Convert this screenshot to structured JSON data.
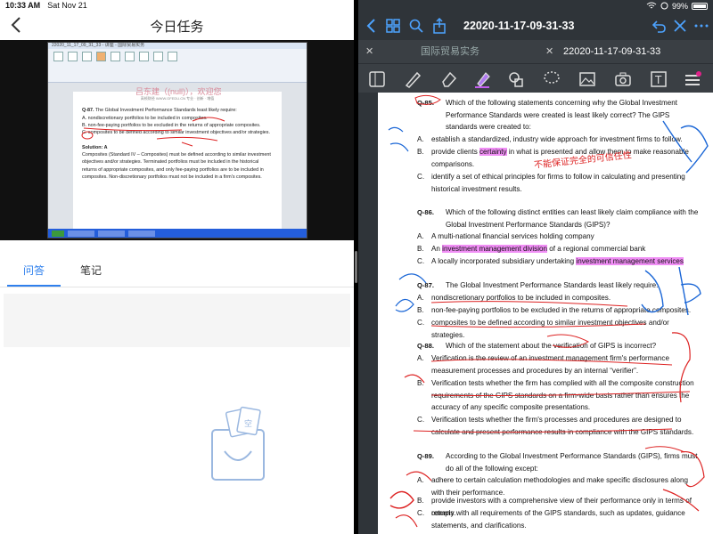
{
  "left": {
    "status": {
      "time": "10:33 AM",
      "date": "Sat Nov 21"
    },
    "nav": {
      "title": "今日任务"
    },
    "video": {
      "window_title": "22020_11_17_09_31_33 - 讲座 - 国际贸易实务",
      "watermark": "吕东建（(null)），欢迎您",
      "doc_header": "高顿财经 WWW.GFEDU.CN 专业 · 创新 · 增值",
      "q_num": "Q-87.",
      "q_text": "The Global Investment Performance Standards least likely require:",
      "options": [
        {
          "letter": "A.",
          "text": "nondiscretionary portfolios to be included in composites."
        },
        {
          "letter": "B.",
          "text": "non-fee-paying portfolios to be excluded in the returns of appropriate composites."
        },
        {
          "letter": "C.",
          "text": "composites to be defined according to similar investment objectives and/or strategies."
        }
      ],
      "solution_label": "Solution: A",
      "solution_text": "Composites (Standard IV – Composites) must be defined according to similar investment objectives and/or strategies. Terminated portfolios must be included in the historical returns of appropriate composites, and only fee-paying portfolios are to be included in composites. Non-discretionary portfolios must not be included in a firm's composites."
    },
    "tabs": [
      {
        "label": "问答"
      },
      {
        "label": "笔记"
      }
    ],
    "empty_text": "空"
  },
  "right": {
    "status": {
      "battery": "99%"
    },
    "doc_title": "22020-11-17-09-31-33",
    "tabs": [
      {
        "label": "国际贸易实务"
      },
      {
        "label": "22020-11-17-09-31-33"
      }
    ],
    "annotation": "不能保证完全的可信任性",
    "questions": [
      {
        "num": "Q-85.",
        "text": "Which of the following statements concerning why the Global Investment Performance Standards were created is least likely correct? The GIPS standards were created to:",
        "options": [
          {
            "letter": "A.",
            "text": "establish a standardized, industry wide approach for investment firms to follow."
          },
          {
            "letter": "B.",
            "text_pre": "provide clients ",
            "text_hl": "certainty",
            "text_post": " in what is presented and allow them to make reasonable comparisons."
          },
          {
            "letter": "C.",
            "text": "identify a set of ethical principles for firms to follow in calculating and presenting historical investment results."
          }
        ]
      },
      {
        "num": "Q-86.",
        "text": "Which of the following distinct entities can least likely claim compliance with the Global Investment Performance Standards (GIPS)?",
        "options": [
          {
            "letter": "A.",
            "text": "A multi-national financial services holding company"
          },
          {
            "letter": "B.",
            "text_pre": "An ",
            "text_hl": "investment management division",
            "text_post": " of a regional commercial bank"
          },
          {
            "letter": "C.",
            "text_pre": "A locally incorporated subsidiary undertaking ",
            "text_hl": "investment management services",
            "text_post": ""
          }
        ]
      },
      {
        "num": "Q-87.",
        "text": "The Global Investment Performance Standards least likely require:",
        "options": [
          {
            "letter": "A.",
            "text": "nondiscretionary portfolios to be included in composites."
          },
          {
            "letter": "B.",
            "text": "non-fee-paying portfolios to be excluded in the returns of appropriate composites."
          },
          {
            "letter": "C.",
            "text": "composites to be defined according to similar investment objectives and/or strategies."
          }
        ]
      },
      {
        "num": "Q-88.",
        "text": "Which of the statement about the verification of GIPS is incorrect?",
        "options": [
          {
            "letter": "A.",
            "text": "Verification is the review of an investment management firm's performance measurement processes and procedures by an internal “verifier”."
          },
          {
            "letter": "B.",
            "text": "Verification tests whether the firm has complied with all the composite construction requirements of the GIPS standards on a firm-wide basis rather than ensures the accuracy of any specific composite presentations."
          },
          {
            "letter": "C.",
            "text": "Verification tests whether the firm's processes and procedures are designed to calculate and present performance results in compliance with the GIPS standards."
          }
        ]
      },
      {
        "num": "Q-89.",
        "text": "According to the Global Investment Performance Standards (GIPS), firms must do all of the following except:",
        "options": [
          {
            "letter": "A.",
            "text": "adhere to certain calculation methodologies and make specific disclosures along with their performance."
          },
          {
            "letter": "B.",
            "text": "provide investors with a comprehensive view of their performance only in terms of returns."
          },
          {
            "letter": "C.",
            "text": "comply with all requirements of the GIPS standards, such as updates, guidance statements, and clarifications."
          }
        ]
      }
    ]
  }
}
